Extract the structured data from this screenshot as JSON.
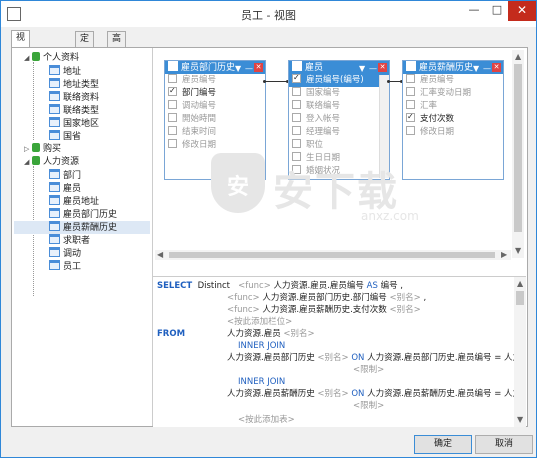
{
  "window": {
    "title": "员工 - 视图",
    "min": "—",
    "max": "□",
    "close": "✕"
  },
  "tabs": [
    "视图创建工具",
    "定义",
    "高级"
  ],
  "tree": {
    "groups": [
      {
        "label": "个人资料",
        "items": [
          "地址",
          "地址类型",
          "联络资料",
          "联络类型",
          "国家地区",
          "国省"
        ]
      },
      {
        "label": "购买",
        "items": []
      },
      {
        "label": "人力资源",
        "items": [
          "部门",
          "雇员",
          "雇员地址",
          "雇员部门历史",
          "雇员薪酬历史",
          "求职者",
          "调动",
          "员工"
        ]
      }
    ],
    "selected": "雇员薪酬历史"
  },
  "tables": [
    {
      "title": "雇员部门历史",
      "fields": [
        {
          "name": "雇员编号",
          "checked": false
        },
        {
          "name": "部门编号",
          "checked": true
        },
        {
          "name": "调动编号",
          "checked": false
        },
        {
          "name": "開始時間",
          "checked": false
        },
        {
          "name": "结束时间",
          "checked": false
        },
        {
          "name": "修改日期",
          "checked": false
        }
      ]
    },
    {
      "title": "雇员",
      "fields": [
        {
          "name": "雇员编号(编号)",
          "checked": true
        },
        {
          "name": "国家编号",
          "checked": false
        },
        {
          "name": "联络编号",
          "checked": false
        },
        {
          "name": "登入帐号",
          "checked": false
        },
        {
          "name": "经理编号",
          "checked": false
        },
        {
          "name": "职位",
          "checked": false
        },
        {
          "name": "生日日期",
          "checked": false
        },
        {
          "name": "婚姻状况",
          "checked": false
        }
      ]
    },
    {
      "title": "雇员薪酬历史",
      "fields": [
        {
          "name": "雇员编号",
          "checked": false
        },
        {
          "name": "汇率变动日期",
          "checked": false
        },
        {
          "name": "汇率",
          "checked": false
        },
        {
          "name": "支付次数",
          "checked": true
        },
        {
          "name": "修改日期",
          "checked": false
        }
      ]
    }
  ],
  "watermark": {
    "text": "安下载",
    "url": "anxz.com"
  },
  "sql": {
    "select_kw": "SELECT",
    "distinct": "Distinct",
    "func": "<func>",
    "col1": "人力资源.雇员.雇员编号",
    "as": "AS",
    "alias1": "编号",
    "col2": "人力资源.雇员部门历史.部门编号",
    "alias_ph": "<别名>",
    "col3": "人力资源.雇员薪酬历史.支付次数",
    "add_col": "<按此添加栏位>",
    "from_kw": "FROM",
    "table1": "人力资源.雇员",
    "inner_join": "INNER JOIN",
    "table2": "人力资源.雇员部门历史",
    "on": "ON",
    "cond2": "人力资源.雇员部门历史.雇员编号 = 人力资源",
    "limit": "<限制>",
    "table3": "人力资源.雇员薪酬历史",
    "cond3": "人力资源.雇员薪酬历史.雇员编号 = 人力资源",
    "add_tbl": "<按此添加表>"
  },
  "buttons": {
    "ok": "确定",
    "cancel": "取消"
  },
  "colors": {
    "accent": "#3b8dd6",
    "close": "#e04343",
    "keyword": "#1f5fbf"
  }
}
